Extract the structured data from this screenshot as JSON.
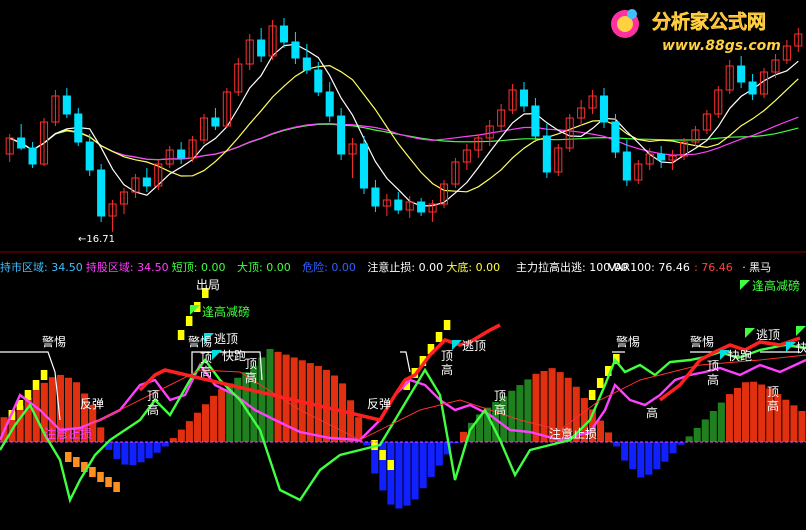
{
  "watermark": {
    "brand": "分析家公式网",
    "url": "www.88gs.com"
  },
  "upper_panel": {
    "low_marker": "←16.71"
  },
  "status_bar": {
    "items": [
      {
        "text": "持市区域: 34.50",
        "color": "#40c0ff"
      },
      {
        "text": "持股区域: 34.50",
        "color": "#ff40ff"
      },
      {
        "text": "短顶: 0.00",
        "color": "#40ff40"
      },
      {
        "text": "大顶: 0.00",
        "color": "#40ff40"
      },
      {
        "text": "危险: 0.00",
        "color": "#3060ff"
      },
      {
        "text": "注意止损: 0.00",
        "color": "#ffffff"
      },
      {
        "text": "大底: 0.00",
        "color": "#ffff40"
      }
    ],
    "right_items": [
      {
        "text": "主力拉高出逃: 100.00",
        "color": "#ffffff"
      },
      {
        "text": "VAR100: 76.46",
        "color": "#ffffff"
      },
      {
        "text": ": 76.46",
        "color": "#ff4040"
      },
      {
        "text": "· 黑马",
        "color": "#ffffff"
      }
    ]
  },
  "annotations": {
    "chuju": "出局",
    "feng_gao": "逢高减磅",
    "tao_ding": "逃顶",
    "kuai_pao": "快跑",
    "jing_ti": "警惕",
    "fan_dan": "反弹",
    "ding": "顶",
    "gao": "高",
    "zhu_yi_zhi_sun": "注意止损",
    "kuai": "快"
  },
  "colors": {
    "up": "#ff3030",
    "down": "#00e0ff",
    "ma5": "#ffffff",
    "ma10": "#ffff60",
    "ma30": "#ff40ff",
    "ma60": "#40ff40",
    "red_bar": "#e03010",
    "green_bar": "#208020",
    "blue_bar": "#1020ff",
    "yellow": "#ffff00",
    "magenta": "#ff40ff",
    "lime": "#40ff40",
    "orange": "#ff9020",
    "cyan": "#00e0e0"
  },
  "chart_data": {
    "type": "candlestick",
    "candles": [
      [
        20.6,
        21.6,
        20.2,
        21.4
      ],
      [
        21.4,
        22.1,
        20.8,
        20.9
      ],
      [
        20.9,
        21.2,
        19.9,
        20.1
      ],
      [
        20.1,
        22.4,
        20.0,
        22.2
      ],
      [
        22.2,
        23.8,
        22.0,
        23.5
      ],
      [
        23.5,
        23.9,
        22.4,
        22.6
      ],
      [
        22.6,
        22.9,
        21.0,
        21.2
      ],
      [
        21.2,
        21.6,
        19.5,
        19.8
      ],
      [
        19.8,
        20.1,
        17.2,
        17.5
      ],
      [
        17.5,
        18.3,
        16.71,
        18.1
      ],
      [
        18.1,
        18.9,
        17.6,
        18.7
      ],
      [
        18.7,
        19.6,
        18.4,
        19.4
      ],
      [
        19.4,
        19.9,
        18.7,
        19.0
      ],
      [
        19.0,
        20.3,
        18.8,
        20.1
      ],
      [
        20.1,
        21.0,
        19.9,
        20.8
      ],
      [
        20.8,
        21.2,
        20.1,
        20.4
      ],
      [
        20.4,
        21.5,
        20.2,
        21.3
      ],
      [
        21.3,
        22.6,
        21.1,
        22.4
      ],
      [
        22.4,
        22.9,
        21.8,
        22.0
      ],
      [
        22.0,
        23.9,
        21.9,
        23.7
      ],
      [
        23.7,
        25.4,
        23.5,
        25.1
      ],
      [
        25.1,
        26.6,
        24.8,
        26.3
      ],
      [
        26.3,
        26.9,
        25.2,
        25.5
      ],
      [
        25.5,
        27.3,
        25.3,
        27.0
      ],
      [
        27.0,
        27.4,
        25.9,
        26.2
      ],
      [
        26.2,
        26.7,
        25.1,
        25.4
      ],
      [
        25.4,
        26.1,
        24.6,
        24.8
      ],
      [
        24.8,
        25.2,
        23.5,
        23.7
      ],
      [
        23.7,
        24.2,
        22.2,
        22.5
      ],
      [
        22.5,
        22.9,
        20.3,
        20.6
      ],
      [
        20.6,
        21.4,
        19.4,
        21.1
      ],
      [
        21.1,
        21.5,
        18.6,
        18.9
      ],
      [
        18.9,
        19.3,
        17.7,
        18.0
      ],
      [
        18.0,
        18.6,
        17.5,
        18.3
      ],
      [
        18.3,
        18.7,
        17.6,
        17.8
      ],
      [
        17.8,
        18.5,
        17.4,
        18.2
      ],
      [
        18.2,
        18.4,
        17.5,
        17.7
      ],
      [
        17.7,
        18.3,
        17.2,
        18.1
      ],
      [
        18.1,
        19.3,
        17.9,
        19.1
      ],
      [
        19.1,
        20.4,
        18.9,
        20.2
      ],
      [
        20.2,
        21.1,
        19.8,
        20.8
      ],
      [
        20.8,
        21.6,
        20.4,
        21.4
      ],
      [
        21.4,
        22.3,
        21.0,
        22.0
      ],
      [
        22.0,
        23.1,
        21.7,
        22.8
      ],
      [
        22.8,
        24.1,
        22.6,
        23.8
      ],
      [
        23.8,
        24.2,
        22.7,
        23.0
      ],
      [
        23.0,
        23.4,
        21.2,
        21.5
      ],
      [
        21.5,
        22.1,
        19.4,
        19.7
      ],
      [
        19.7,
        21.1,
        19.5,
        20.9
      ],
      [
        20.9,
        22.6,
        20.7,
        22.4
      ],
      [
        22.4,
        23.3,
        22.0,
        22.9
      ],
      [
        22.9,
        23.8,
        22.6,
        23.5
      ],
      [
        23.5,
        23.9,
        21.9,
        22.2
      ],
      [
        22.2,
        22.6,
        20.4,
        20.7
      ],
      [
        20.7,
        21.3,
        19.0,
        19.3
      ],
      [
        19.3,
        20.3,
        19.1,
        20.1
      ],
      [
        20.1,
        20.9,
        19.8,
        20.6
      ],
      [
        20.6,
        21.0,
        19.9,
        20.3
      ],
      [
        20.3,
        20.8,
        19.8,
        20.5
      ],
      [
        20.5,
        21.4,
        20.3,
        21.2
      ],
      [
        21.2,
        22.0,
        21.0,
        21.8
      ],
      [
        21.8,
        22.8,
        21.6,
        22.6
      ],
      [
        22.6,
        24.0,
        22.4,
        23.8
      ],
      [
        23.8,
        25.3,
        23.6,
        25.0
      ],
      [
        25.0,
        25.5,
        23.9,
        24.2
      ],
      [
        24.2,
        24.6,
        23.3,
        23.6
      ],
      [
        23.6,
        24.9,
        23.4,
        24.7
      ],
      [
        24.7,
        25.6,
        24.4,
        25.3
      ],
      [
        25.3,
        26.3,
        25.1,
        26.0
      ],
      [
        26.0,
        26.9,
        25.7,
        26.6
      ]
    ],
    "ylim": [
      16,
      28
    ]
  }
}
